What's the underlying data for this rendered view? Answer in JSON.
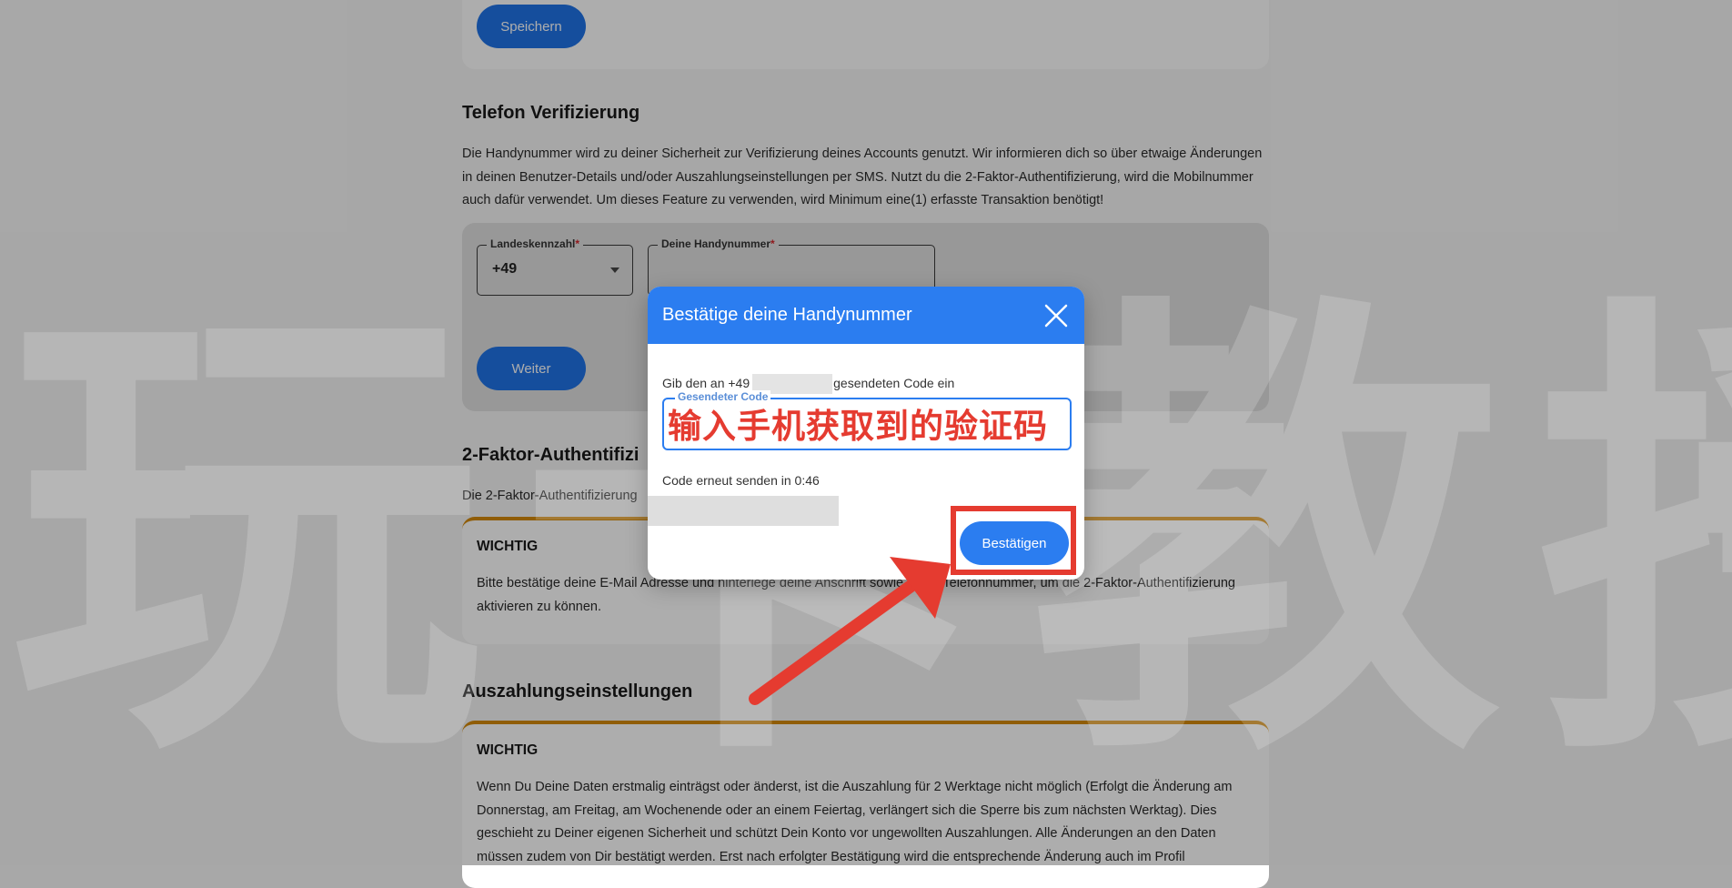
{
  "top_section": {
    "save_label": "Speichern"
  },
  "phone_section": {
    "title": "Telefon Verifizierung",
    "description": "Die Handynummer wird zu deiner Sicherheit zur Verifizierung deines Accounts genutzt. Wir informieren dich so über etwaige Änderungen in deinen Benutzer-Details und/oder Auszahlungseinstellungen per SMS. Nutzt du die 2-Faktor-Authentifizierung, wird die Mobilnummer auch dafür verwendet. Um dieses Feature zu verwenden, wird Minimum eine(1) erfasste Transaktion benötigt!",
    "country_code_label": "Landeskennzahl",
    "country_code_value": "+49",
    "phone_label": "Deine Handynummer",
    "required_mark": "*",
    "next_label": "Weiter"
  },
  "twofa_section": {
    "title": "2-Faktor-Authentifizi",
    "description": "Die 2-Faktor-Authentifizierung",
    "warning_title": "WICHTIG",
    "warning_text": "Bitte bestätige deine E-Mail Adresse und hinterlege deine Anschrift sowie deine Telefonnummer, um die 2-Faktor-Authentifizierung aktivieren zu können."
  },
  "payout_section": {
    "title": "Auszahlungseinstellungen",
    "warning_title": "WICHTIG",
    "warning_text": "Wenn Du Deine Daten erstmalig einträgst oder änderst, ist die Auszahlung für 2 Werktage nicht möglich (Erfolgt die Änderung am Donnerstag, am Freitag, am Wochenende oder an einem Feiertag, verlängert sich die Sperre bis zum nächsten Werktag). Dies geschieht zu Deiner eigenen Sicherheit und schützt Dein Konto vor ungewollten Auszahlungen. Alle Änderungen an den Daten müssen zudem von Dir bestätigt werden. Erst nach erfolgter Bestätigung wird die entsprechende Änderung auch im Profil"
  },
  "modal": {
    "title": "Bestätige deine Handynummer",
    "instruction_prefix": "Gib den an +49",
    "instruction_suffix": "gesendeten Code ein",
    "code_label": "Gesendeter Code",
    "code_value": "输入手机获取到的验证码",
    "resend_text": "Code erneut senden in 0:46",
    "confirm_label": "Bestätigen"
  },
  "watermark": "玩卡教授",
  "annotation_color": "#e53b30"
}
